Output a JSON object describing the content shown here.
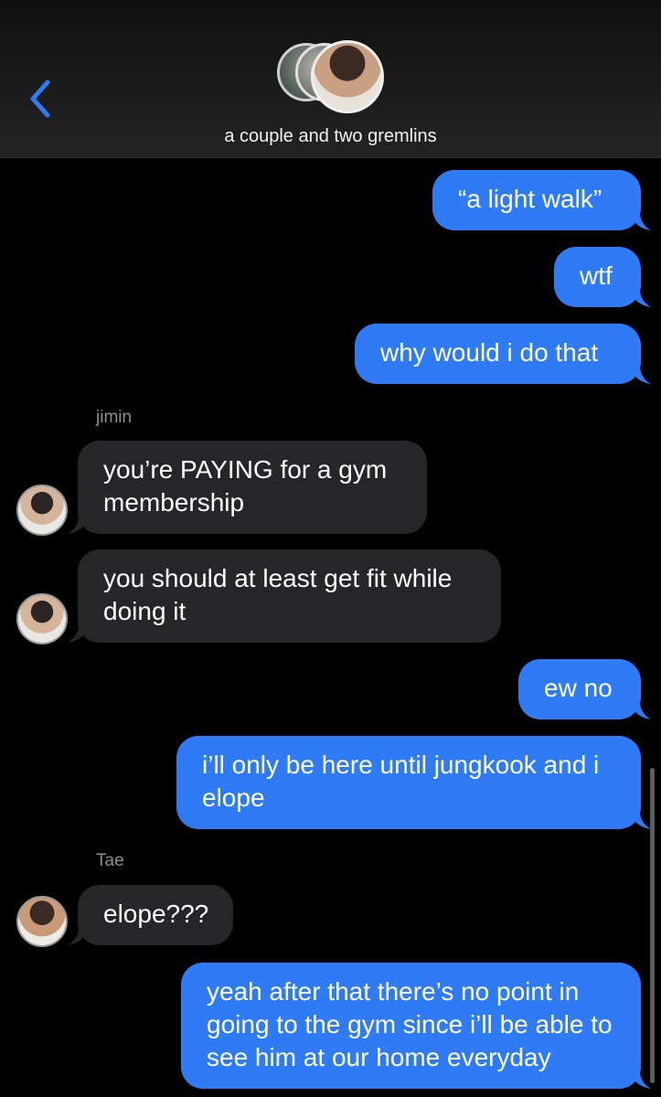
{
  "header": {
    "title": "a couple and two gremlins",
    "back_icon": "chevron-left-icon",
    "accent": "#2f7bf6"
  },
  "messages": [
    {
      "direction": "out",
      "text": "“a light walk”"
    },
    {
      "direction": "out",
      "text": "wtf"
    },
    {
      "direction": "out",
      "text": "why would i do that"
    },
    {
      "direction": "in",
      "sender": "jimin",
      "text": "you’re PAYING for a gym membership"
    },
    {
      "direction": "in",
      "text": "you should at least get fit while doing it"
    },
    {
      "direction": "out",
      "text": "ew no"
    },
    {
      "direction": "out",
      "text": "i’ll only be here until jungkook and i elope"
    },
    {
      "direction": "in",
      "sender": "Tae",
      "text": "elope???"
    },
    {
      "direction": "out",
      "text": "yeah after that there’s no point in going to the gym since i’ll be able to see him at our home everyday"
    }
  ],
  "colors": {
    "outgoing_bubble": "#2f7bf6",
    "incoming_bubble": "#262628",
    "background": "#000000"
  }
}
